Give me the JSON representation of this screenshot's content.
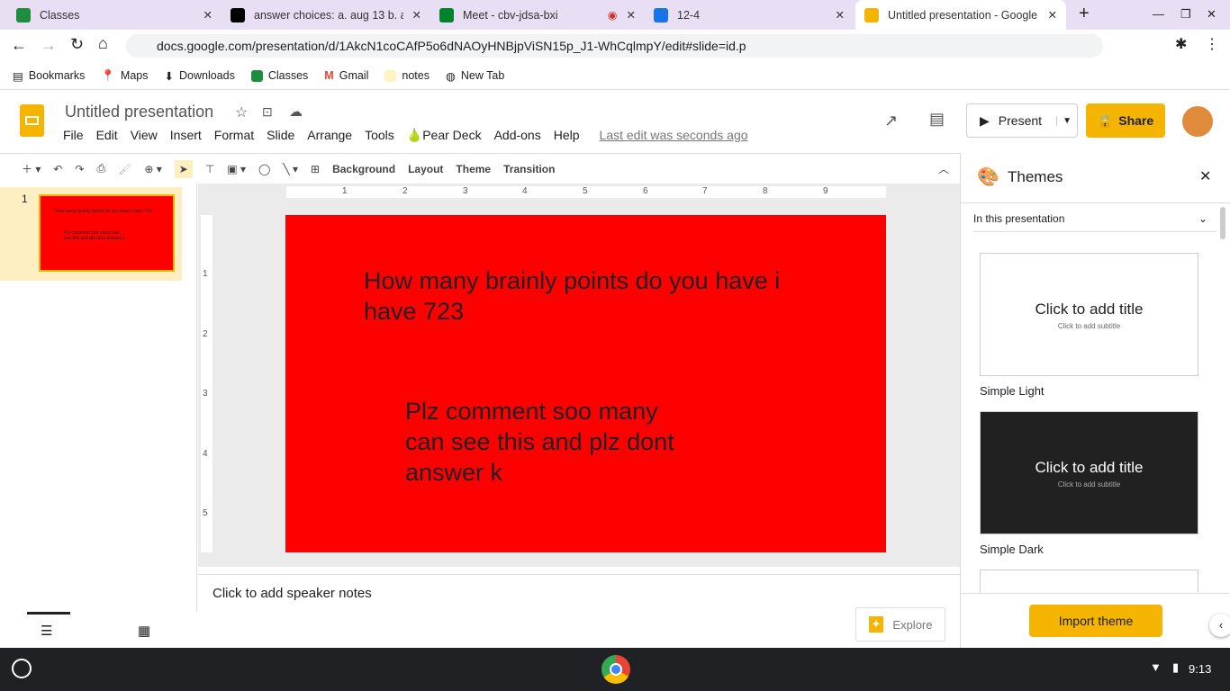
{
  "browser": {
    "tabs": [
      {
        "title": "Classes",
        "color": "#1e8e3e"
      },
      {
        "title": "answer choices: a. aug 13 b. au",
        "color": "#000"
      },
      {
        "title": "Meet - cbv-jdsa-bxi",
        "color": "#00832d"
      },
      {
        "title": "12-4",
        "color": "#1a73e8"
      },
      {
        "title": "Untitled presentation - Google S",
        "color": "#f4b400"
      }
    ],
    "url": "docs.google.com/presentation/d/1AkcN1coCAfP5o6dNAOyHNBjpViSN15p_J1-WhCqlmpY/edit#slide=id.p",
    "bookmarks": [
      "Bookmarks",
      "Maps",
      "Downloads",
      "Classes",
      "Gmail",
      "notes",
      "New Tab"
    ]
  },
  "app": {
    "title": "Untitled presentation",
    "menus": [
      "File",
      "Edit",
      "View",
      "Insert",
      "Format",
      "Slide",
      "Arrange",
      "Tools",
      "Pear Deck",
      "Add-ons",
      "Help"
    ],
    "last_edit": "Last edit was seconds ago",
    "present": "Present",
    "share": "Share"
  },
  "toolbar": {
    "background": "Background",
    "layout": "Layout",
    "theme": "Theme",
    "transition": "Transition"
  },
  "ruler": [
    "1",
    "2",
    "3",
    "4",
    "5",
    "6",
    "7",
    "8",
    "9"
  ],
  "vruler": [
    "1",
    "2",
    "3",
    "4",
    "5"
  ],
  "slides": [
    {
      "num": "1",
      "title": "How many brainly points do you have i have 723",
      "body": "Plz comment soo many can see this and plz dont answer k",
      "bg": "#ff0000"
    }
  ],
  "notes": "Click to add speaker notes",
  "explore": "Explore",
  "themes": {
    "title": "Themes",
    "filter": "In this presentation",
    "items": [
      {
        "name": "Simple Light",
        "title": "Click to add title",
        "subtitle": "Click to add subtitle"
      },
      {
        "name": "Simple Dark",
        "title": "Click to add title",
        "subtitle": "Click to add subtitle"
      }
    ],
    "import": "Import theme"
  },
  "taskbar": {
    "time": "9:13"
  }
}
